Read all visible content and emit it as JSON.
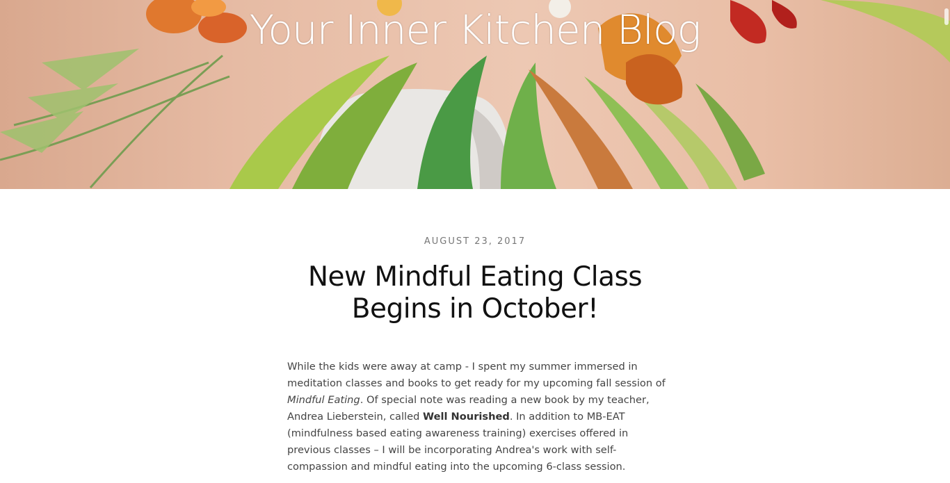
{
  "header": {
    "site_title": "Your Inner Kitchen Blog"
  },
  "post": {
    "date": "AUGUST 23, 2017",
    "title": "New Mindful Eating Class Begins in October!",
    "body": {
      "part1": "While the kids were away at camp - I spent my summer immersed in meditation classes and books to get ready for my upcoming fall session of ",
      "em1": "Mindful Eating",
      "part2": ".  Of special note was reading a new book by my teacher, Andrea Lieberstein, called ",
      "strong1": "Well Nourished",
      "part3": ".  In addition to MB-EAT (mindfulness based eating awareness training) exercises offered in previous classes – I will be incorporating Andrea's work with self-compassion and mindful eating into the upcoming 6-class session."
    }
  },
  "colors": {
    "title_text": "#111111",
    "body_text": "#444444",
    "date_text": "#777777",
    "banner_bg": "#e6bba4"
  }
}
